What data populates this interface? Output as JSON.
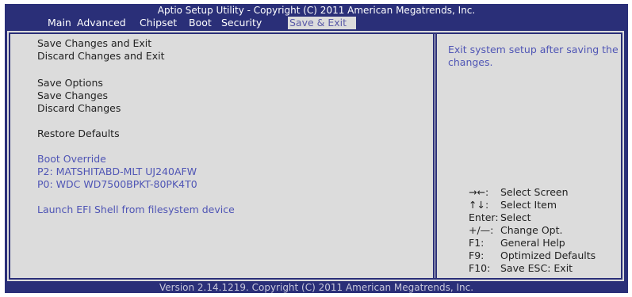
{
  "window": {
    "title": "Aptio Setup Utility - Copyright (C) 2011 American Megatrends, Inc.",
    "footer": "Version 2.14.1219. Copyright (C) 2011 American Megatrends, Inc."
  },
  "menu": {
    "tabs": [
      "Main",
      "Advanced",
      "Chipset",
      "Boot",
      "Security",
      "Save & Exit"
    ],
    "active": "Save & Exit"
  },
  "options": {
    "save_changes_exit": "Save Changes and Exit",
    "discard_changes_exit": "Discard Changes and Exit",
    "save_options": "Save Options",
    "save_changes": "Save Changes",
    "discard_changes": "Discard Changes",
    "restore_defaults": "Restore Defaults",
    "boot_override": "Boot Override",
    "boot_device_1": "P2:  MATSHITABD-MLT UJ240AFW",
    "boot_device_2": "P0:  WDC WD7500BPKT-80PK4T0",
    "launch_efi_shell": "Launch EFI Shell from filesystem device"
  },
  "help": {
    "text": "Exit system setup after saving the changes."
  },
  "keys": [
    {
      "key": "→←:",
      "desc": "Select Screen"
    },
    {
      "key": "↑↓:",
      "desc": "Select Item"
    },
    {
      "key": "Enter:",
      "desc": "Select"
    },
    {
      "key": "+/—:",
      "desc": "Change Opt."
    },
    {
      "key": "F1:",
      "desc": "General Help"
    },
    {
      "key": "F9:",
      "desc": "Optimized Defaults"
    },
    {
      "key": "F10:",
      "desc": "Save    ESC:  Exit"
    }
  ],
  "colors": {
    "frame": "#2a2f78",
    "panel": "#dcdcdc",
    "accent_text": "#4f55b5"
  }
}
